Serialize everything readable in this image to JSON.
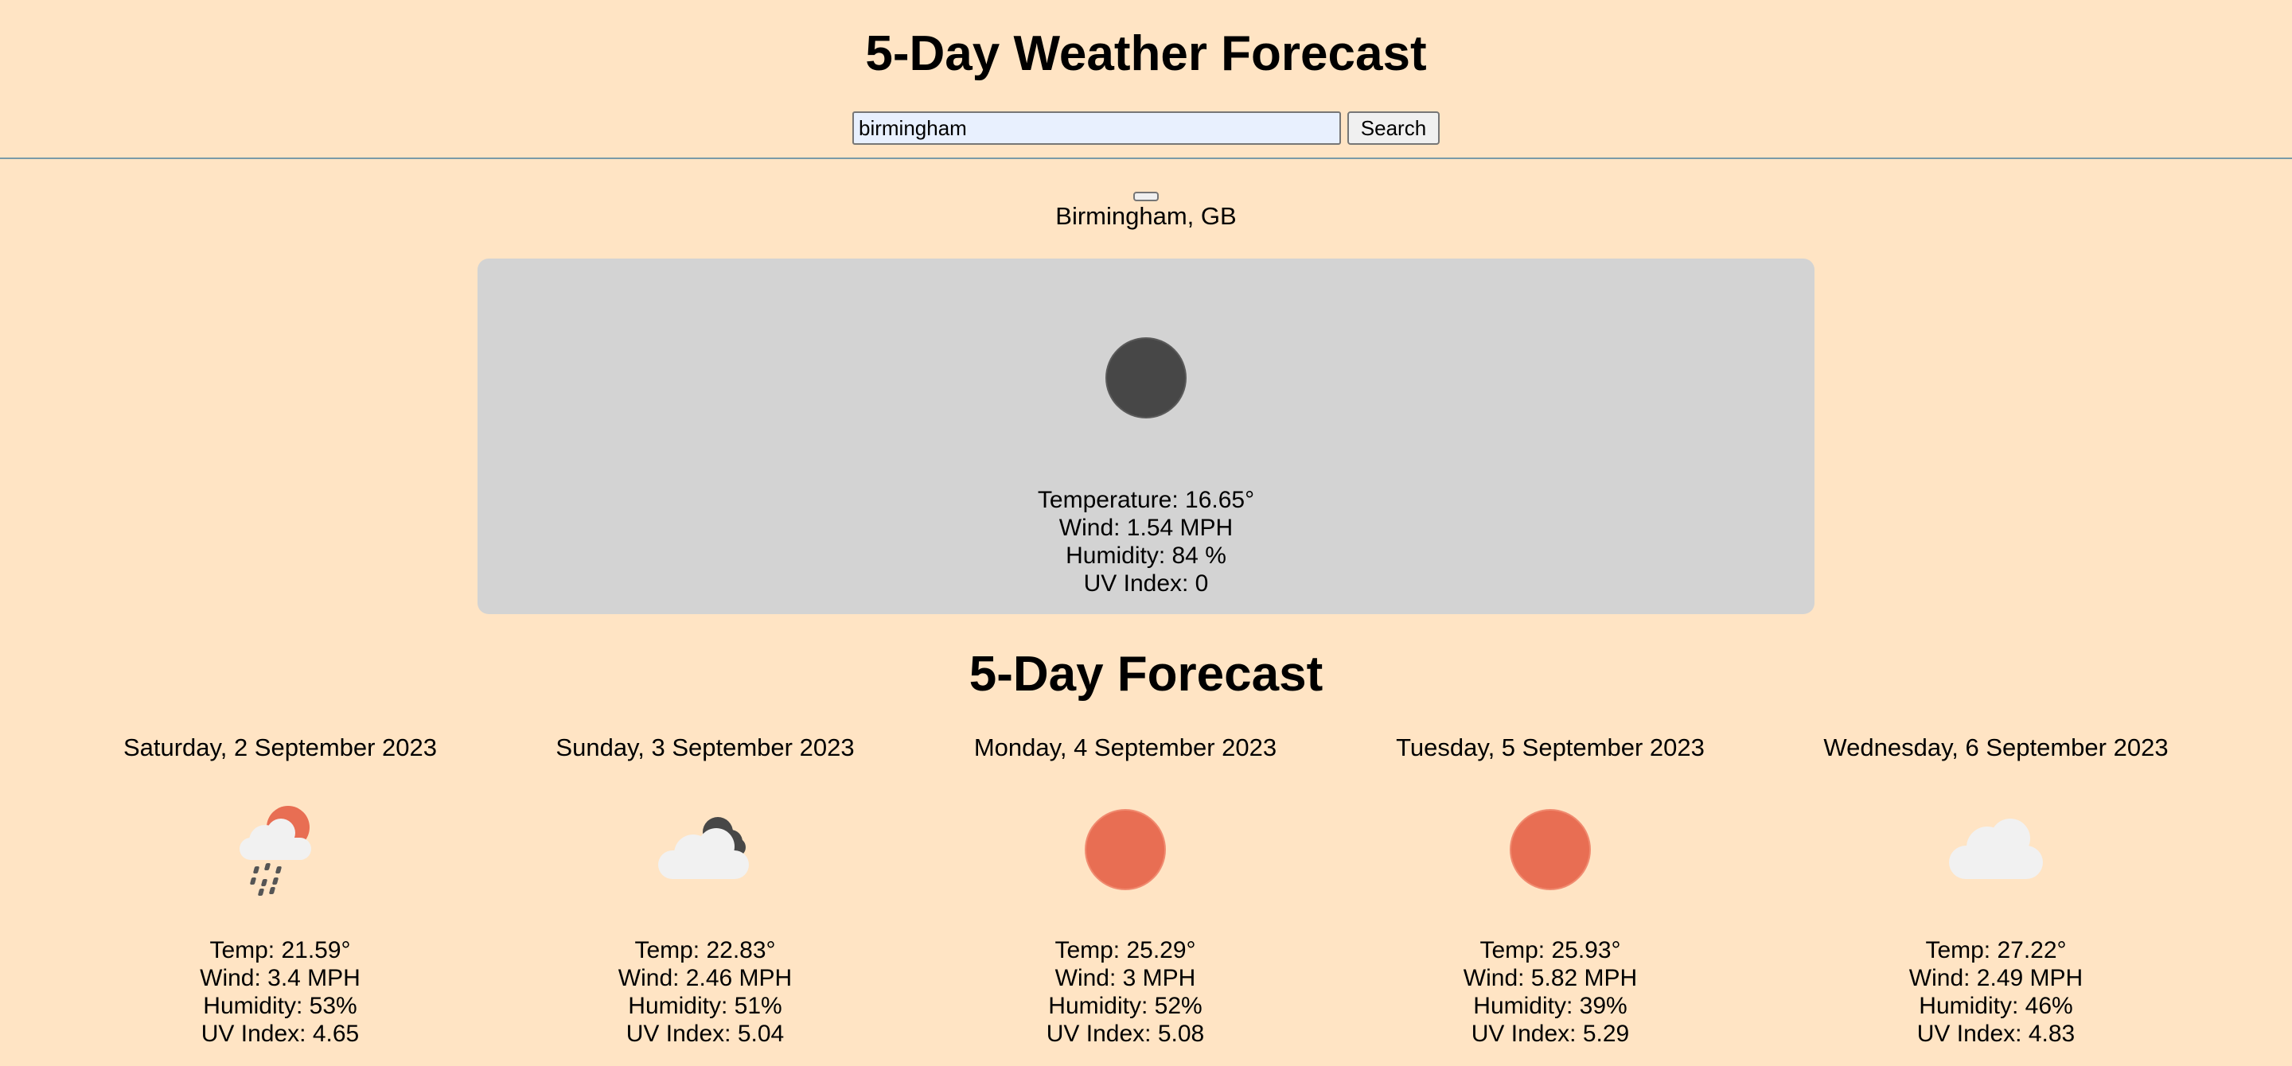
{
  "header": {
    "title": "5-Day Weather Forecast",
    "search_value": "birmingham",
    "search_button_label": "Search"
  },
  "current": {
    "city": "Birmingham, GB",
    "icon": "night-clear-icon",
    "temperature": "Temperature: 16.65°",
    "wind": "Wind: 1.54 MPH",
    "humidity": "Humidity: 84 %",
    "uv_index": "UV Index: 0"
  },
  "forecast": {
    "heading": "5-Day Forecast",
    "days": [
      {
        "date": "Saturday, 2 September 2023",
        "icon": "sun-cloud-rain-icon",
        "temp": "Temp: 21.59°",
        "wind": "Wind: 3.4 MPH",
        "humidity": "Humidity: 53%",
        "uv_index": "UV Index: 4.65"
      },
      {
        "date": "Sunday, 3 September 2023",
        "icon": "broken-clouds-icon",
        "temp": "Temp: 22.83°",
        "wind": "Wind: 2.46 MPH",
        "humidity": "Humidity: 51%",
        "uv_index": "UV Index: 5.04"
      },
      {
        "date": "Monday, 4 September 2023",
        "icon": "clear-sun-icon",
        "temp": "Temp: 25.29°",
        "wind": "Wind: 3 MPH",
        "humidity": "Humidity: 52%",
        "uv_index": "UV Index: 5.08"
      },
      {
        "date": "Tuesday, 5 September 2023",
        "icon": "clear-sun-icon",
        "temp": "Temp: 25.93°",
        "wind": "Wind: 5.82 MPH",
        "humidity": "Humidity: 39%",
        "uv_index": "UV Index: 5.29"
      },
      {
        "date": "Wednesday, 6 September 2023",
        "icon": "cloud-icon",
        "temp": "Temp: 27.22°",
        "wind": "Wind: 2.49 MPH",
        "humidity": "Humidity: 46%",
        "uv_index": "UV Index: 4.83"
      }
    ]
  },
  "colors": {
    "background": "#ffe4c4",
    "card": "#d3d3d3",
    "sun": "#e86e53",
    "night": "#474747",
    "input_bg": "#e8f0fe"
  }
}
